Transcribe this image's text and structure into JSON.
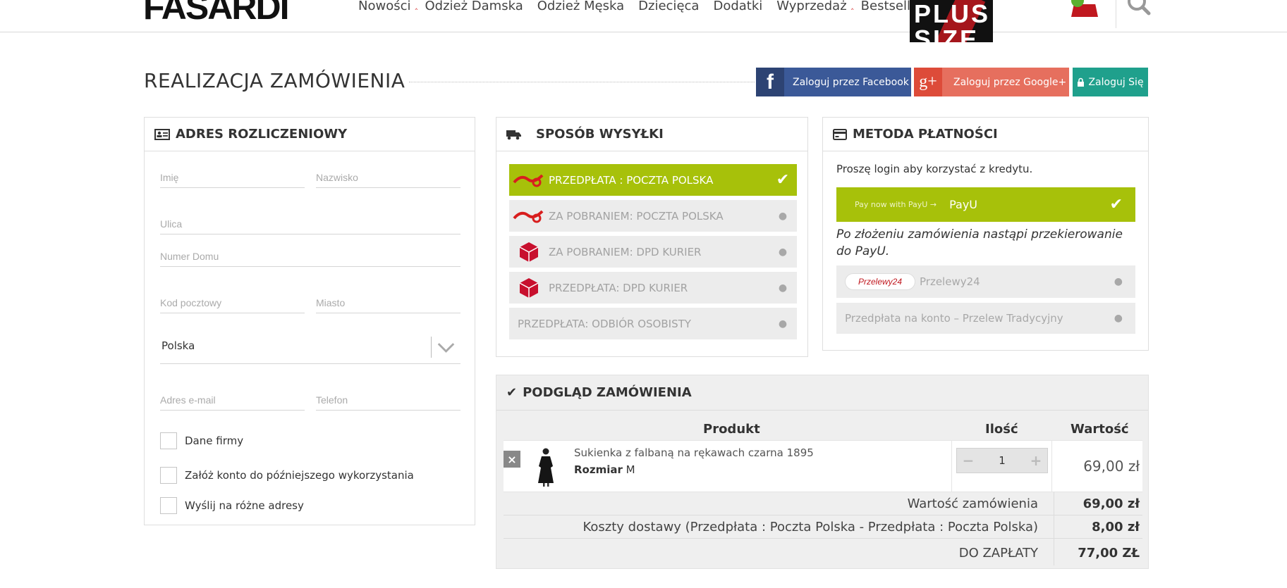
{
  "header": {
    "logo": "FASARDI",
    "nav": [
      "Nowości",
      "Odzież Damska",
      "Odzież Męska",
      "Dziecięca",
      "Dodatki",
      "Wyprzedaż",
      "Bestsellery"
    ],
    "plus_size": "PLUS SIZE",
    "cart_icon": "cart-icon",
    "search_icon": "search-icon"
  },
  "page": {
    "title": "REALIZACJA ZAMÓWIENIA",
    "login_facebook": "Zaloguj przez Facebook",
    "login_google": "Zaloguj przez Google+",
    "login": "Zaloguj Się"
  },
  "billing": {
    "title": "ADRES ROZLICZENIOWY",
    "first_name": "Imię",
    "last_name": "Nazwisko",
    "street": "Ulica",
    "house_number": "Numer Domu",
    "postcode": "Kod pocztowy",
    "city": "Miasto",
    "country": "Polska",
    "email": "Adres e-mail",
    "phone": "Telefon",
    "company": "Dane firmy",
    "create_account": "Załóż konto do późniejszego wykorzystania",
    "ship_other": "Wyślij na różne adresy"
  },
  "shipping": {
    "title": "SPOSÓB WYSYŁKI",
    "options": [
      {
        "label": "PRZEDPŁATA : POCZTA POLSKA",
        "selected": true
      },
      {
        "label": "ZA POBRANIEM: POCZTA POLSKA",
        "selected": false
      },
      {
        "label": "ZA POBRANIEM: DPD KURIER",
        "selected": false
      },
      {
        "label": "PRZEDPŁATA: DPD KURIER",
        "selected": false
      },
      {
        "label": "PRZEDPŁATA: ODBIÓR OSOBISTY",
        "selected": false
      }
    ]
  },
  "payment": {
    "title": "METODA PŁATNOŚCI",
    "login_note": "Proszę login aby korzystać z kredytu.",
    "payu_logo": "Pay now with PayU →",
    "payu": "PayU",
    "payu_info": "Po złożeniu zamówienia nastąpi przekierowanie do PayU.",
    "p24_logo": "Przelewy24",
    "przelewy24": "Przelewy24",
    "transfer": "Przedpłata na konto – Przelew Tradycyjny"
  },
  "order": {
    "title": "PODGLĄD ZAMÓWIENIA",
    "col_product": "Produkt",
    "col_qty": "Ilość",
    "col_value": "Wartość",
    "item_name": "Sukienka z falbaną na rękawach czarna 1895",
    "size_label": "Rozmiar",
    "size_value": "M",
    "quantity": "1",
    "item_price": "69,00 zł",
    "subtotal_label": "Wartość zamówienia",
    "subtotal": "69,00 zł",
    "shipping_label": "Koszty dostawy (Przedpłata : Poczta Polska - Przedpłata : Poczta Polska)",
    "shipping_cost": "8,00 zł",
    "total_label": "DO ZAPŁATY",
    "total": "77,00 ZŁ"
  },
  "colors": {
    "accent_green": "#a7c10a",
    "facebook": "#3b5998",
    "google": "#e66f5e",
    "login": "#1fa08c",
    "brand_red": "#c0181f"
  }
}
